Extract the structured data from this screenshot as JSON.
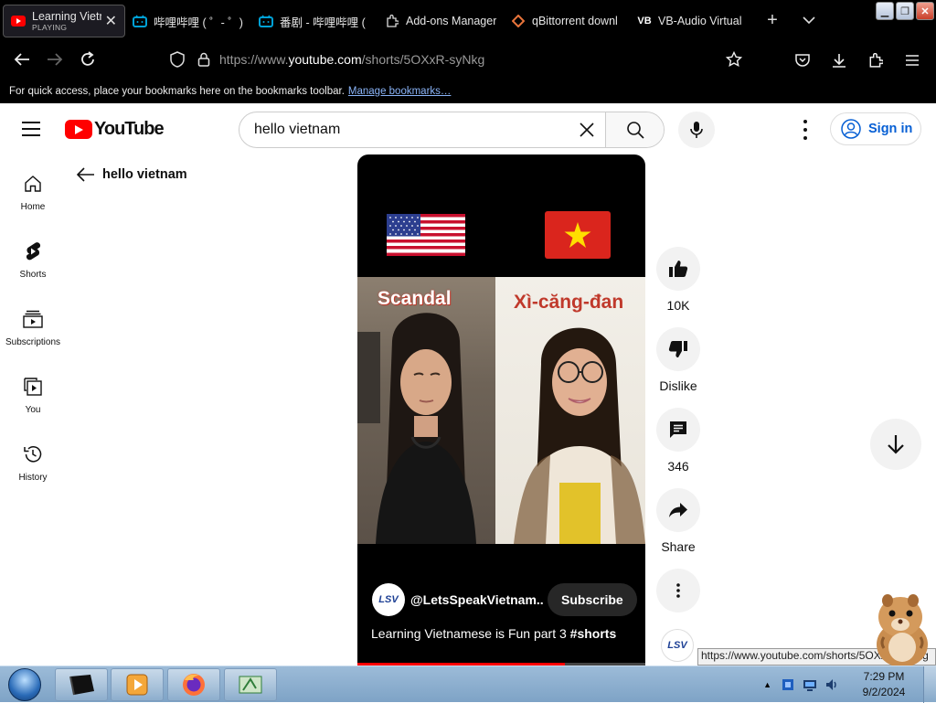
{
  "browser": {
    "tabs": [
      {
        "title": "Learning Vietnamese",
        "subtitle": "PLAYING",
        "active": true
      },
      {
        "title": "哔哩哔哩 ( ゜- ゜)つ"
      },
      {
        "title": "番剧 - 哔哩哔哩 ("
      },
      {
        "title": "Add-ons Manager"
      },
      {
        "title": "qBittorrent downl"
      },
      {
        "title": "VB-Audio Virtual"
      }
    ],
    "url_prefix": "https://www.",
    "url_domain": "youtube.com",
    "url_path": "/shorts/5OXxR-syNkg",
    "bookmarks_text": "For quick access, place your bookmarks here on the bookmarks toolbar.",
    "bookmarks_link": "Manage bookmarks…"
  },
  "youtube": {
    "logo_text": "YouTube",
    "search_value": "hello vietnam",
    "sign_in": "Sign in",
    "back_label": "hello vietnam",
    "sidebar": [
      {
        "label": "Home",
        "icon": "home-icon"
      },
      {
        "label": "Shorts",
        "icon": "shorts-icon"
      },
      {
        "label": "Subscriptions",
        "icon": "subscriptions-icon"
      },
      {
        "label": "You",
        "icon": "you-icon"
      },
      {
        "label": "History",
        "icon": "history-icon"
      }
    ],
    "video": {
      "word_left": "Scandal",
      "word_right": "Xì-căng-đan",
      "channel_avatar": "LSV",
      "channel": "@LetsSpeakVietnam...",
      "subscribe": "Subscribe",
      "caption": "Learning Vietnamese is Fun part 3",
      "hashtag": "#shorts",
      "progress": 0.72
    },
    "actions": {
      "likes": "10K",
      "dislike": "Dislike",
      "comments": "346",
      "share": "Share"
    }
  },
  "status_url": "https://www.youtube.com/shorts/5OXxR-syNkg",
  "taskbar": {
    "time": "7:29 PM",
    "date": "9/2/2024"
  },
  "colors": {
    "brand_red": "#ff0000",
    "link_blue": "#065fd4"
  }
}
